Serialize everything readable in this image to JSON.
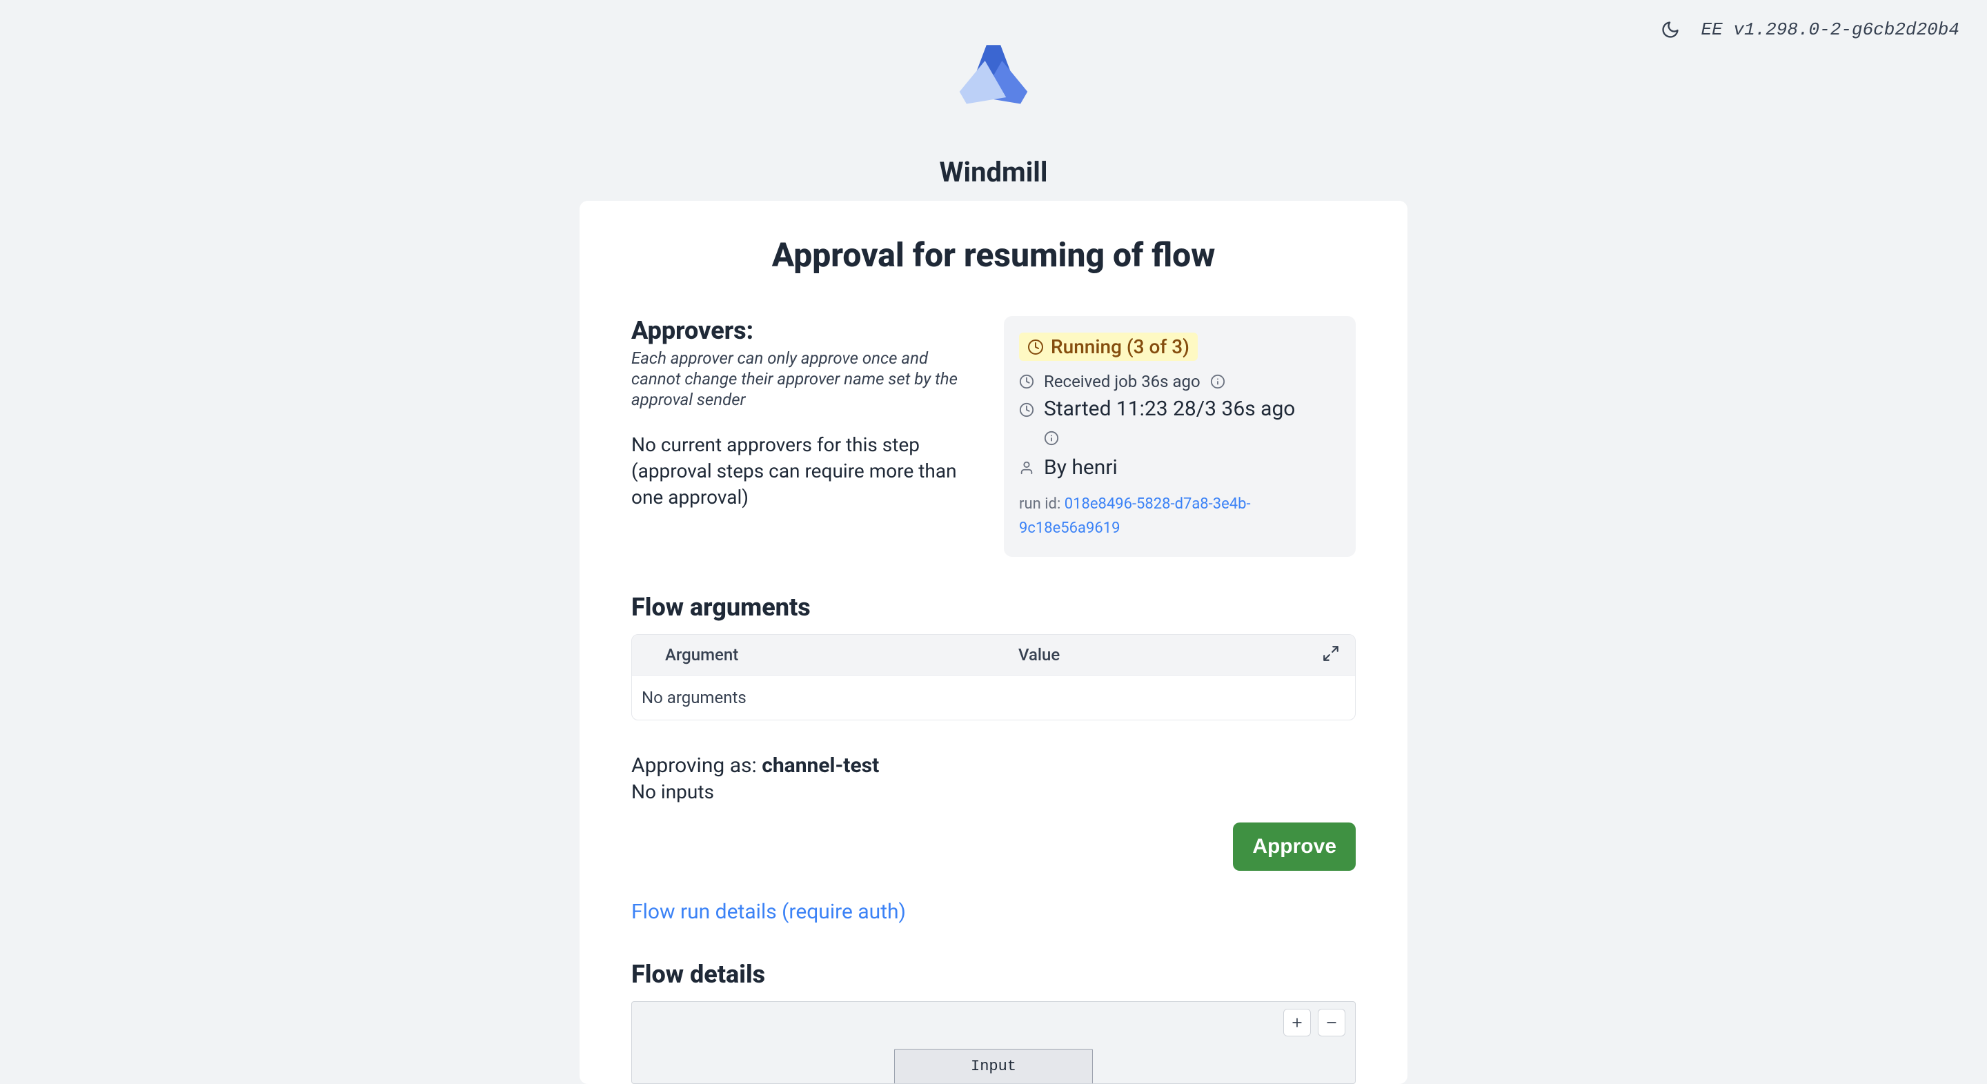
{
  "version": "EE v1.298.0-2-g6cb2d20b4",
  "brand": "Windmill",
  "title": "Approval for resuming of flow",
  "approvers": {
    "heading": "Approvers:",
    "hint": "Each approver can only approve once and cannot change their approver name set by the approval sender",
    "none": "No current approvers for this step (approval steps can require more than one approval)"
  },
  "status": {
    "label": "Running (3 of 3)",
    "received": "Received job 36s ago",
    "started": "Started 11:23 28/3 36s ago",
    "by_prefix": "By ",
    "by_user": "henri",
    "run_id_label": "run id: ",
    "run_id": "018e8496-5828-d7a8-3e4b-9c18e56a9619"
  },
  "flow_args": {
    "heading": "Flow arguments",
    "col_arg": "Argument",
    "col_val": "Value",
    "empty": "No arguments"
  },
  "approving": {
    "prefix": "Approving as: ",
    "who": "channel-test",
    "no_inputs": "No inputs"
  },
  "approve_btn": "Approve",
  "flow_run_link": "Flow run details (require auth)",
  "flow_details": {
    "heading": "Flow details",
    "input_node": "Input"
  }
}
